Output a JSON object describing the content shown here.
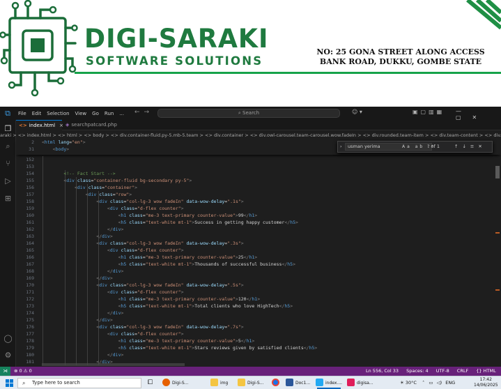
{
  "letterhead": {
    "brand": "DIGI-SARAKI",
    "tagline": "SOFTWARE SOLUTIONS",
    "address_line1": "NO: 25 GONA STREET ALONG ACCESS",
    "address_line2": "BANK ROAD, DUKKU, GOMBE STATE",
    "brand_color": "#1f7a3f",
    "line_color": "#16a34a"
  },
  "vscode": {
    "menu": [
      "File",
      "Edit",
      "Selection",
      "View",
      "Go",
      "Run",
      "..."
    ],
    "search_placeholder": "Search",
    "tabs": [
      {
        "label": "index.html",
        "active": true
      },
      {
        "label": "searchpatcard.php",
        "active": false
      }
    ],
    "breadcrumbs": "araki  >  <> index.html  >  <> html  >  <> body  >  <> div.container-fluid.py-5.mb-5.team  >  <> div.container  >  <> div.owl-carousel.team-carousel.wow.fadeIn  >  <> div.rounded.team-item  >  <> div.team-content  >  <> div.team-img-icon",
    "find": {
      "query": "usman yerima",
      "count": "? of 1",
      "options": "Aa ab .*"
    },
    "sticky_lines": [
      {
        "n": "2",
        "html": "<span class=\"p\">&lt;</span><span class=\"t\">html</span> <span class=\"a\">lang</span><span class=\"x\">=</span><span class=\"s\">\"en\"</span><span class=\"p\">&gt;</span>"
      },
      {
        "n": "31",
        "html": "    <span class=\"p\">&lt;</span><span class=\"t\">body</span><span class=\"p\">&gt;</span>"
      }
    ],
    "lines": [
      {
        "n": "152",
        "html": ""
      },
      {
        "n": "153",
        "html": ""
      },
      {
        "n": "154",
        "html": "        <span class=\"c\">&lt;!-- Fact Start --&gt;</span>"
      },
      {
        "n": "155",
        "html": "        <span class=\"p\">&lt;</span><span class=\"t\">div</span> <span class=\"a\">class</span><span class=\"x\">=</span><span class=\"s\">\"container-fluid bg-secondary py-5\"</span><span class=\"p\">&gt;</span>"
      },
      {
        "n": "156",
        "html": "            <span class=\"p\">&lt;</span><span class=\"t\">div</span> <span class=\"a\">class</span><span class=\"x\">=</span><span class=\"s\">\"container\"</span><span class=\"p\">&gt;</span>"
      },
      {
        "n": "157",
        "html": "                <span class=\"p\">&lt;</span><span class=\"t\">div</span> <span class=\"a\">class</span><span class=\"x\">=</span><span class=\"s\">\"row\"</span><span class=\"p\">&gt;</span>"
      },
      {
        "n": "158",
        "html": "                    <span class=\"p\">&lt;</span><span class=\"t\">div</span> <span class=\"a\">class</span><span class=\"x\">=</span><span class=\"s\">\"col-lg-3 wow fadeIn\"</span> <span class=\"a\">data-wow-delay</span><span class=\"x\">=</span><span class=\"s\">\".1s\"</span><span class=\"p\">&gt;</span>"
      },
      {
        "n": "159",
        "html": "                        <span class=\"p\">&lt;</span><span class=\"t\">div</span> <span class=\"a\">class</span><span class=\"x\">=</span><span class=\"s\">\"d-flex counter\"</span><span class=\"p\">&gt;</span>"
      },
      {
        "n": "160",
        "html": "                            <span class=\"p\">&lt;</span><span class=\"t\">h1</span> <span class=\"a\">class</span><span class=\"x\">=</span><span class=\"s\">\"me-3 text-primary counter-value\"</span><span class=\"p\">&gt;</span><span class=\"x\">99</span><span class=\"p\">&lt;/</span><span class=\"t\">h1</span><span class=\"p\">&gt;</span>"
      },
      {
        "n": "161",
        "html": "                            <span class=\"p\">&lt;</span><span class=\"t\">h5</span> <span class=\"a\">class</span><span class=\"x\">=</span><span class=\"s\">\"text-white mt-1\"</span><span class=\"p\">&gt;</span><span class=\"x\">Success in getting happy customer</span><span class=\"p\">&lt;/</span><span class=\"t\">h5</span><span class=\"p\">&gt;</span>"
      },
      {
        "n": "162",
        "html": "                        <span class=\"p\">&lt;/</span><span class=\"t\">div</span><span class=\"p\">&gt;</span>"
      },
      {
        "n": "163",
        "html": "                    <span class=\"p\">&lt;/</span><span class=\"t\">div</span><span class=\"p\">&gt;</span>"
      },
      {
        "n": "164",
        "html": "                    <span class=\"p\">&lt;</span><span class=\"t\">div</span> <span class=\"a\">class</span><span class=\"x\">=</span><span class=\"s\">\"col-lg-3 wow fadeIn\"</span> <span class=\"a\">data-wow-delay</span><span class=\"x\">=</span><span class=\"s\">\".3s\"</span><span class=\"p\">&gt;</span>"
      },
      {
        "n": "165",
        "html": "                        <span class=\"p\">&lt;</span><span class=\"t\">div</span> <span class=\"a\">class</span><span class=\"x\">=</span><span class=\"s\">\"d-flex counter\"</span><span class=\"p\">&gt;</span>"
      },
      {
        "n": "166",
        "html": "                            <span class=\"p\">&lt;</span><span class=\"t\">h1</span> <span class=\"a\">class</span><span class=\"x\">=</span><span class=\"s\">\"me-3 text-primary counter-value\"</span><span class=\"p\">&gt;</span><span class=\"x\">25</span><span class=\"p\">&lt;/</span><span class=\"t\">h1</span><span class=\"p\">&gt;</span>"
      },
      {
        "n": "167",
        "html": "                            <span class=\"p\">&lt;</span><span class=\"t\">h5</span> <span class=\"a\">class</span><span class=\"x\">=</span><span class=\"s\">\"text-white mt-1\"</span><span class=\"p\">&gt;</span><span class=\"x\">Thousands of successful business</span><span class=\"p\">&lt;/</span><span class=\"t\">h5</span><span class=\"p\">&gt;</span>"
      },
      {
        "n": "168",
        "html": "                        <span class=\"p\">&lt;/</span><span class=\"t\">div</span><span class=\"p\">&gt;</span>"
      },
      {
        "n": "169",
        "html": "                    <span class=\"p\">&lt;/</span><span class=\"t\">div</span><span class=\"p\">&gt;</span>"
      },
      {
        "n": "170",
        "html": "                    <span class=\"p\">&lt;</span><span class=\"t\">div</span> <span class=\"a\">class</span><span class=\"x\">=</span><span class=\"s\">\"col-lg-3 wow fadeIn\"</span> <span class=\"a\">data-wow-delay</span><span class=\"x\">=</span><span class=\"s\">\".5s\"</span><span class=\"p\">&gt;</span>"
      },
      {
        "n": "171",
        "html": "                        <span class=\"p\">&lt;</span><span class=\"t\">div</span> <span class=\"a\">class</span><span class=\"x\">=</span><span class=\"s\">\"d-flex counter\"</span><span class=\"p\">&gt;</span>"
      },
      {
        "n": "172",
        "html": "                            <span class=\"p\">&lt;</span><span class=\"t\">h1</span> <span class=\"a\">class</span><span class=\"x\">=</span><span class=\"s\">\"me-3 text-primary counter-value\"</span><span class=\"p\">&gt;</span><span class=\"x\">120</span><span class=\"p\">&lt;/</span><span class=\"t\">h1</span><span class=\"p\">&gt;</span>"
      },
      {
        "n": "173",
        "html": "                            <span class=\"p\">&lt;</span><span class=\"t\">h5</span> <span class=\"a\">class</span><span class=\"x\">=</span><span class=\"s\">\"text-white mt-1\"</span><span class=\"p\">&gt;</span><span class=\"x\">Total clients who love HighTech</span><span class=\"p\">&lt;/</span><span class=\"t\">h5</span><span class=\"p\">&gt;</span>"
      },
      {
        "n": "174",
        "html": "                        <span class=\"p\">&lt;/</span><span class=\"t\">div</span><span class=\"p\">&gt;</span>"
      },
      {
        "n": "175",
        "html": "                    <span class=\"p\">&lt;/</span><span class=\"t\">div</span><span class=\"p\">&gt;</span>"
      },
      {
        "n": "176",
        "html": "                    <span class=\"p\">&lt;</span><span class=\"t\">div</span> <span class=\"a\">class</span><span class=\"x\">=</span><span class=\"s\">\"col-lg-3 wow fadeIn\"</span> <span class=\"a\">data-wow-delay</span><span class=\"x\">=</span><span class=\"s\">\".7s\"</span><span class=\"p\">&gt;</span>"
      },
      {
        "n": "177",
        "html": "                        <span class=\"p\">&lt;</span><span class=\"t\">div</span> <span class=\"a\">class</span><span class=\"x\">=</span><span class=\"s\">\"d-flex counter\"</span><span class=\"p\">&gt;</span>"
      },
      {
        "n": "178",
        "html": "                            <span class=\"p\">&lt;</span><span class=\"t\">h1</span> <span class=\"a\">class</span><span class=\"x\">=</span><span class=\"s\">\"me-3 text-primary counter-value\"</span><span class=\"p\">&gt;</span><span class=\"x\">5</span><span class=\"p\">&lt;/</span><span class=\"t\">h1</span><span class=\"p\">&gt;</span>"
      },
      {
        "n": "179",
        "html": "                            <span class=\"p\">&lt;</span><span class=\"t\">h5</span> <span class=\"a\">class</span><span class=\"x\">=</span><span class=\"s\">\"text-white mt-1\"</span><span class=\"p\">&gt;</span><span class=\"x\">Stars reviews given by satisfied clients</span><span class=\"p\">&lt;/</span><span class=\"t\">h5</span><span class=\"p\">&gt;</span>"
      },
      {
        "n": "180",
        "html": "                        <span class=\"p\">&lt;/</span><span class=\"t\">div</span><span class=\"p\">&gt;</span>"
      },
      {
        "n": "181",
        "html": "                    <span class=\"p\">&lt;/</span><span class=\"t\">div</span><span class=\"p\">&gt;</span>"
      }
    ],
    "status": {
      "left": "⊗ 0 ⚠ 0",
      "position": "Ln 556, Col 33",
      "spaces": "Spaces: 4",
      "encoding": "UTF-8",
      "eol": "CRLF",
      "language": "{} HTML",
      "color": "#68217a"
    }
  },
  "taskbar": {
    "search_placeholder": "Type here to search",
    "items": [
      {
        "label": "Digi-S...",
        "color": "#e66000"
      },
      {
        "label": "img",
        "color": "#f4c542"
      },
      {
        "label": "Digi-S...",
        "color": "#f4c542"
      },
      {
        "label": "",
        "color": "#1a73e8"
      },
      {
        "label": "Doc1...",
        "color": "#2b579a"
      },
      {
        "label": "index....",
        "color": "#23a9f2"
      },
      {
        "label": "digisa...",
        "color": "#e01e5a"
      }
    ],
    "weather": "30°C",
    "lang": "ENG",
    "time": "17:42",
    "date": "14/06/2025"
  }
}
